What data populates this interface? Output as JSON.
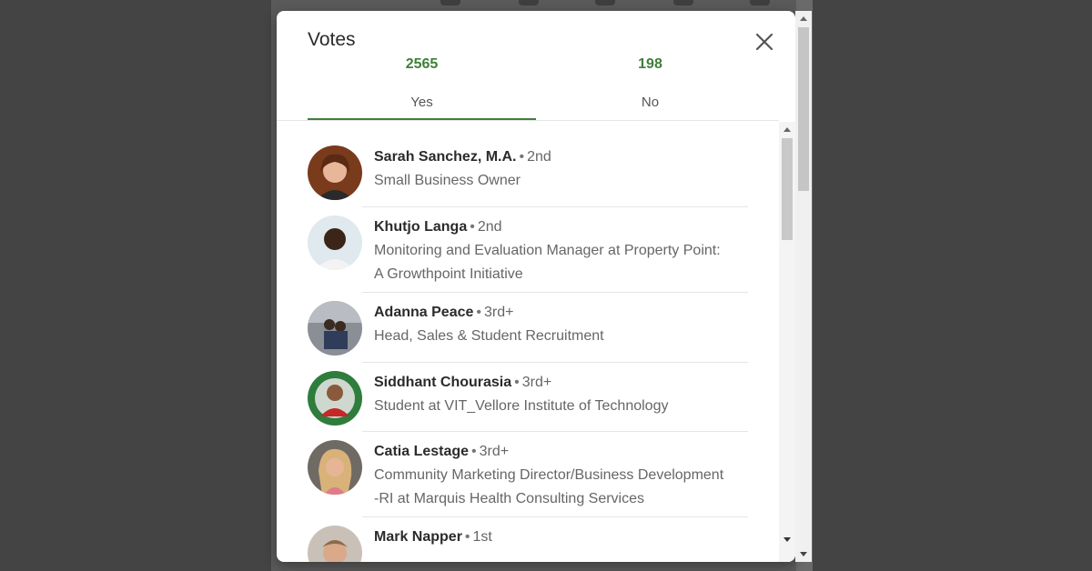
{
  "modal": {
    "title": "Votes",
    "tabs": [
      {
        "count": "2565",
        "label": "Yes",
        "selected": true
      },
      {
        "count": "198",
        "label": "No",
        "selected": false
      }
    ],
    "voters": [
      {
        "name": "Sarah Sanchez, M.A.",
        "degree": "2nd",
        "headline": [
          "Small Business Owner"
        ]
      },
      {
        "name": "Khutjo Langa",
        "degree": "2nd",
        "headline": [
          "Monitoring and Evaluation Manager at Property Point:",
          "A Growthpoint Initiative"
        ]
      },
      {
        "name": "Adanna Peace",
        "degree": "3rd+",
        "headline": [
          "Head, Sales & Student Recruitment"
        ]
      },
      {
        "name": "Siddhant Chourasia",
        "degree": "3rd+",
        "headline": [
          "Student at VIT_Vellore Institute of Technology"
        ]
      },
      {
        "name": "Catia Lestage",
        "degree": "3rd+",
        "headline": [
          "Community Marketing Director/Business Development",
          "-RI at Marquis Health Consulting Services"
        ]
      },
      {
        "name": "Mark Napper",
        "degree": "1st",
        "headline": []
      }
    ],
    "separator": "•"
  },
  "colors": {
    "accent": "#3f7f3a",
    "overlay": "#444444",
    "modal_bg": "#ffffff"
  },
  "icons": {
    "close": "close-icon",
    "scroll_up": "arrow-up-icon",
    "scroll_down": "arrow-down-icon"
  }
}
